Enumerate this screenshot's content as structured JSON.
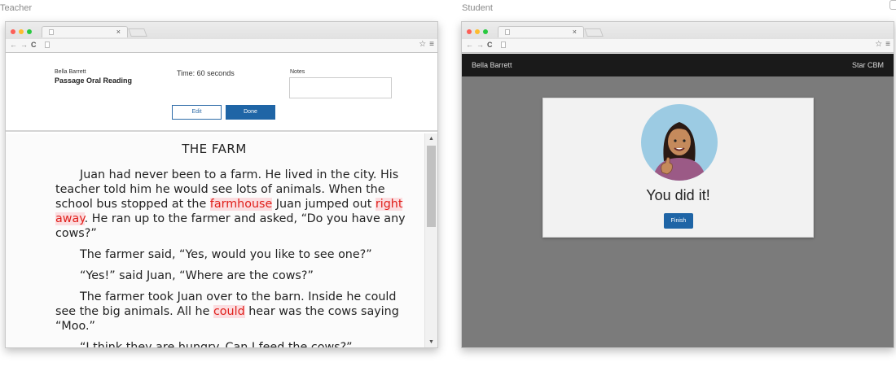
{
  "panes": {
    "teacher_label": "Teacher",
    "student_label": "Student"
  },
  "browser": {
    "tab_close": "×",
    "nav_icons": [
      "←",
      "→",
      "C"
    ],
    "star": "☆",
    "menu": "≡"
  },
  "teacher": {
    "student_name": "Bella Barrett",
    "assessment_title": "Passage Oral Reading",
    "time_label": "Time: 60 seconds",
    "notes_label": "Notes",
    "notes_value": "",
    "edit_label": "Edit",
    "done_label": "Done",
    "passage": {
      "title": "THE FARM",
      "p1": {
        "a": "Juan had never been to a farm.  He lived in the city.  His teacher told him he would see lots of animals. When the school bus stopped at the ",
        "err1": "farmhouse",
        "b": " Juan jumped out ",
        "err2": "right away",
        "c": ".  He ran up to the farmer and asked, “Do you have any cows?”"
      },
      "p2": "The farmer said, “Yes, would you like to see one?”",
      "p3": "“Yes!” said Juan, “Where are the cows?”",
      "p4": {
        "a": "The farmer took Juan over to the barn.  Inside he could see the big animals.  All he ",
        "err1": "could",
        "b": " hear was the cows saying “Moo.”"
      },
      "p5": "“I think they are hungry.  Can I feed the cows?”"
    },
    "scroll_up": "▲",
    "scroll_down": "▼"
  },
  "student": {
    "name": "Bella Barrett",
    "brand": "Star CBM",
    "message": "You did it!",
    "finish_label": "Finish"
  },
  "colors": {
    "accent": "#1f65a6",
    "error_text": "#e0201b",
    "error_bg": "#fbdde0",
    "student_bg": "#7b7b7b",
    "topbar": "#1a1a1a"
  }
}
